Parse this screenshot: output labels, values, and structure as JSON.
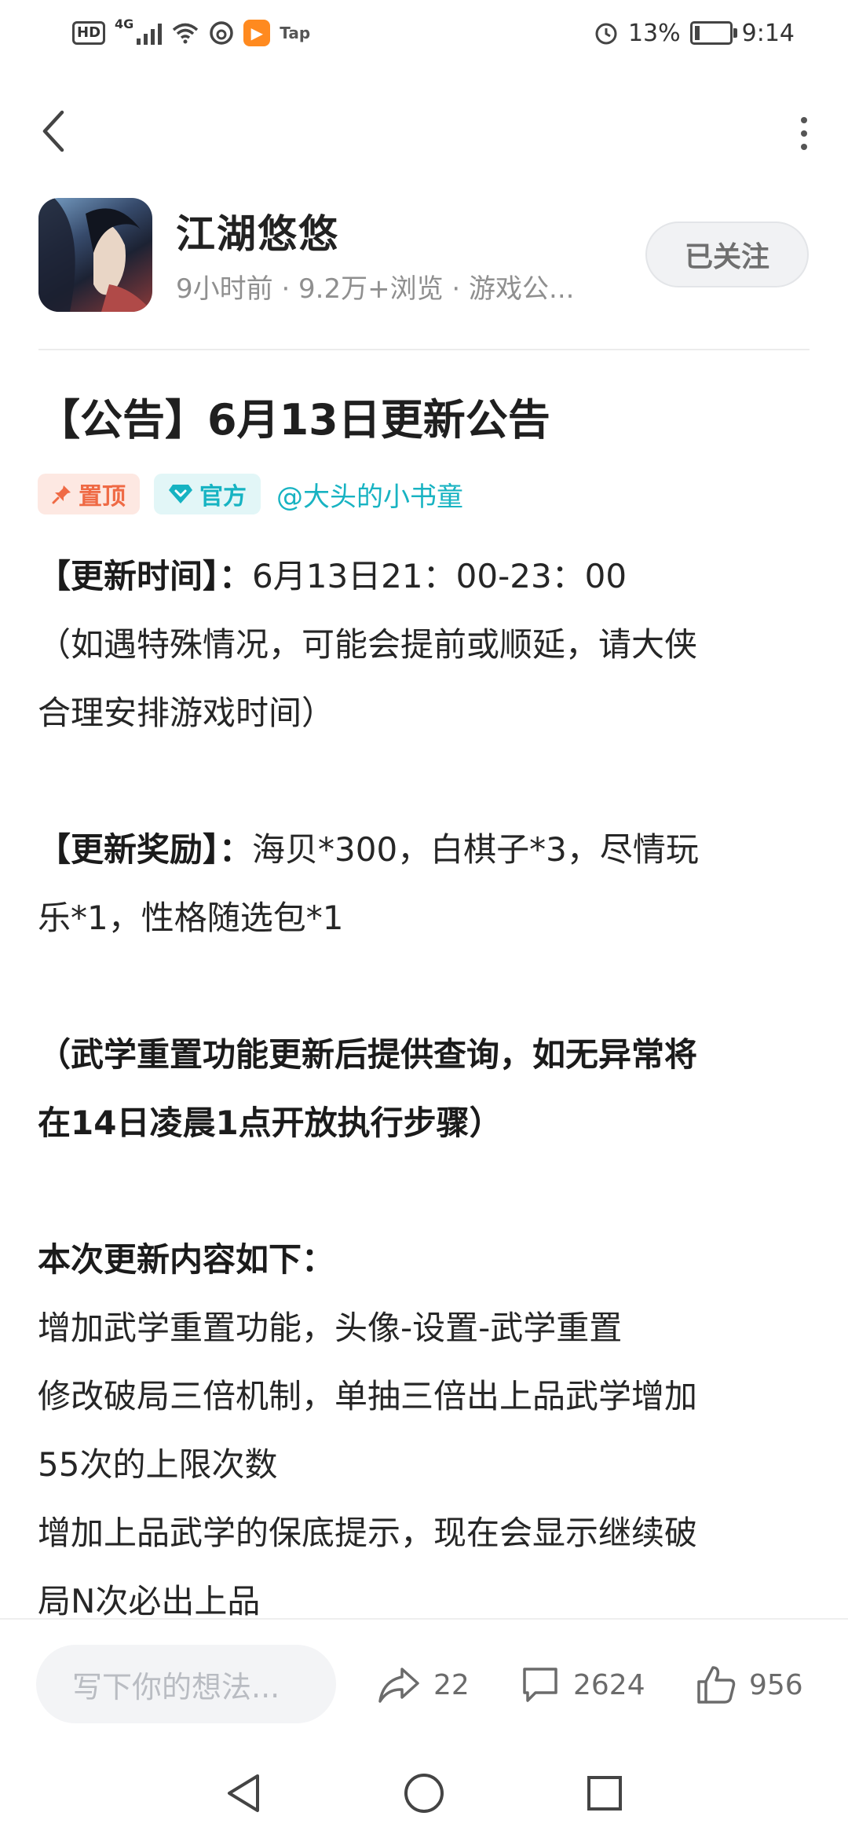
{
  "status_bar": {
    "hd": "HD",
    "network": "4G",
    "tap_label": "Tap",
    "battery": "13%",
    "time": "9:14"
  },
  "header": {
    "author_name": "江湖悠悠",
    "meta": "9小时前 · 9.2万+浏览 · 游戏公...",
    "follow_label": "已关注"
  },
  "article": {
    "title": "【公告】6月13日更新公告",
    "tags": {
      "pinned": "置顶",
      "official": "官方",
      "author": "@大头的小书童"
    },
    "update_time_label": "【更新时间】：",
    "update_time_value": "6月13日21：00-23：00",
    "notice_line1": "（如遇特殊情况，可能会提前或顺延，请大侠",
    "notice_line2": "合理安排游戏时间）",
    "reward_label": "【更新奖励】：",
    "reward_value_line1": "海贝*300，白棋子*3，尽情玩",
    "reward_value_line2": "乐*1，性格随选包*1",
    "bold_notice_line1": "（武学重置功能更新后提供查询，如无异常将",
    "bold_notice_line2": "在14日凌晨1点开放执行步骤）",
    "content_heading": "本次更新内容如下：",
    "content_line1": "增加武学重置功能，头像-设置-武学重置",
    "content_line2": "修改破局三倍机制，单抽三倍出上品武学增加",
    "content_line3": "55次的上限次数",
    "content_line4": "增加上品武学的保底提示，现在会显示继续破",
    "content_line5": "局N次必出上品"
  },
  "bottom_bar": {
    "comment_placeholder": "写下你的想法...",
    "share_count": "22",
    "comment_count": "2624",
    "like_count": "956"
  },
  "icons": {
    "back": "back-arrow-icon",
    "more": "more-vertical-icon",
    "pin": "pin-icon",
    "official": "diamond-heart-icon",
    "share": "share-icon",
    "comment": "comment-icon",
    "like": "thumbs-up-icon"
  },
  "colors": {
    "accent_teal": "#16b3c2",
    "pin_orange": "#ef6a45",
    "text_dark": "#1f1f1f",
    "meta_gray": "#8f8f8f"
  }
}
